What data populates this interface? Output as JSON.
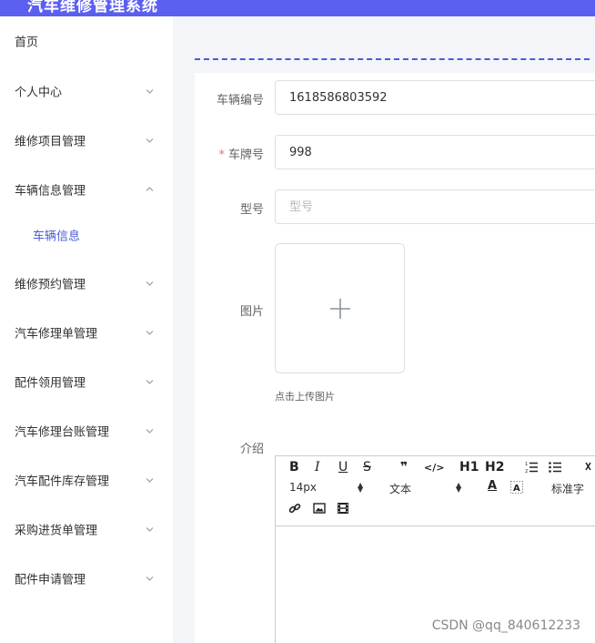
{
  "header": {
    "title": "汽车维修管理系统"
  },
  "sidebar": {
    "items": [
      {
        "label": "首页"
      },
      {
        "label": "个人中心"
      },
      {
        "label": "维修项目管理"
      },
      {
        "label": "车辆信息管理"
      },
      {
        "label": "车辆信息"
      },
      {
        "label": "维修预约管理"
      },
      {
        "label": "汽车修理单管理"
      },
      {
        "label": "配件领用管理"
      },
      {
        "label": "汽车修理台账管理"
      },
      {
        "label": "汽车配件库存管理"
      },
      {
        "label": "采购进货单管理"
      },
      {
        "label": "配件申请管理"
      }
    ]
  },
  "form": {
    "vehicle_no": {
      "label": "车辆编号",
      "value": "1618586803592"
    },
    "plate": {
      "required_mark": "*",
      "label": "车牌号",
      "value": "998"
    },
    "model": {
      "label": "型号",
      "placeholder": "型号"
    },
    "image": {
      "label": "图片",
      "tip": "点击上传图片"
    },
    "intro": {
      "label": "介绍"
    }
  },
  "editor": {
    "bold": "B",
    "italic": "I",
    "underline": "U",
    "strike": "S",
    "quote": "❞",
    "code": "</>",
    "h1": "H1",
    "h2": "H2",
    "font_size": "14px",
    "text_style": "文本",
    "font_color": "A",
    "font_family": "标准字",
    "icons": [
      "ordered-list",
      "bullet-list",
      "link",
      "image",
      "video"
    ]
  },
  "watermark": "CSDN @qq_840612233",
  "colors": {
    "accent": "#5b5ff0",
    "link": "#4a5bd8",
    "required": "#f56c6c"
  }
}
